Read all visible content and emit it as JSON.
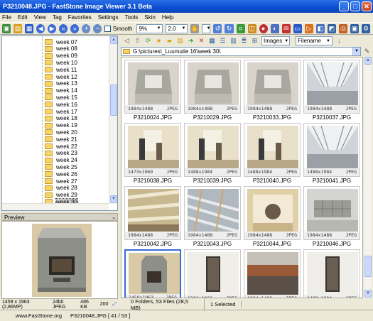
{
  "window": {
    "title": "P3210048.JPG  -  FastStone Image Viewer 3.1 Beta",
    "min": "_",
    "max": "□",
    "close": "✕"
  },
  "menu": [
    "File",
    "Edit",
    "View",
    "Tag",
    "Favorites",
    "Settings",
    "Tools",
    "Skin",
    "Help"
  ],
  "toolbar": {
    "smooth_label": "Smooth",
    "zoom_value": "9%",
    "ratio_value": "2.0"
  },
  "tree": {
    "items": [
      "week 07",
      "week 08",
      "week 09",
      "week 10",
      "week 11",
      "week 12",
      "week 13",
      "week 14",
      "week 15",
      "week 16",
      "week 17",
      "week 18",
      "week 19",
      "week 20",
      "week 21",
      "week 22",
      "week 23",
      "week 24",
      "week 25",
      "week 26",
      "week 27",
      "week 28",
      "week 29",
      "week 30"
    ],
    "selected_index": 23
  },
  "preview": {
    "label": "Preview"
  },
  "info": {
    "dims": "1459 x 1963 (2,86MP)",
    "bits": "24bit JPEG",
    "size": "486 KB",
    "zoom": "200"
  },
  "browser": {
    "filter_value": "Images",
    "sort_value": "Filename",
    "path": "G:\\pictures\\_Luumutie 16\\week 30\\"
  },
  "thumbnails": [
    {
      "name": "P3210024.JPG",
      "res": "1984x1488",
      "fmt": "JPEG",
      "kind": "cell"
    },
    {
      "name": "P3210029.JPG",
      "res": "1984x1488",
      "fmt": "JPEG",
      "kind": "cell"
    },
    {
      "name": "P3210033.JPG",
      "res": "1984x1488",
      "fmt": "JPEG",
      "kind": "cell"
    },
    {
      "name": "P3210037.JPG",
      "res": "1984x1488",
      "fmt": "JPEG",
      "kind": "attic"
    },
    {
      "name": "P3210038.JPG",
      "res": "1473x1969",
      "fmt": "JPEG",
      "kind": "room"
    },
    {
      "name": "P3210039.JPG",
      "res": "1488x1984",
      "fmt": "JPEG",
      "kind": "room"
    },
    {
      "name": "P3210040.JPG",
      "res": "1488x1984",
      "fmt": "JPEG",
      "kind": "room"
    },
    {
      "name": "P3210041.JPG",
      "res": "1488x1984",
      "fmt": "JPEG",
      "kind": "attic"
    },
    {
      "name": "P3210042.JPG",
      "res": "1984x1488",
      "fmt": "JPEG",
      "kind": "ceiling"
    },
    {
      "name": "P3210043.JPG",
      "res": "1984x1488",
      "fmt": "JPEG",
      "kind": "ceiling2"
    },
    {
      "name": "P3210044.JPG",
      "res": "1984x1488",
      "fmt": "JPEG",
      "kind": "hole"
    },
    {
      "name": "P3210046.JPG",
      "res": "1984x1488",
      "fmt": "JPEG",
      "kind": "stone"
    },
    {
      "name": "P3210048.JPG",
      "res": "1459x1963",
      "fmt": "JPEG",
      "kind": "stove"
    },
    {
      "name": "",
      "res": "1396x1991",
      "fmt": "JPEG",
      "kind": "door"
    },
    {
      "name": "",
      "res": "1984x1488",
      "fmt": "JPEG",
      "kind": "floor"
    },
    {
      "name": "",
      "res": "1488x1984",
      "fmt": "JPEG",
      "kind": "door"
    }
  ],
  "status": {
    "folders": "0 Folders, 53 Files (28,5 MB)",
    "selected": "1 Selected"
  },
  "bottom": {
    "site": "www.FastStone.org",
    "current": "P3210048.JPG [ 41 / 53 ]"
  },
  "colors": {
    "title_blue": "#0a4fd0",
    "selection_blue": "#3a6bd6",
    "folder_yellow": "#f5d46a"
  }
}
